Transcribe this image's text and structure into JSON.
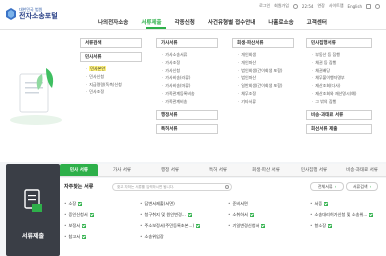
{
  "util": {
    "items": [
      "로그인",
      "회원가입",
      "22:54",
      "연장",
      "사이트맵",
      "English",
      "상담"
    ],
    "colors": {
      "accent": "#2eb04a",
      "brand": "#243c84"
    }
  },
  "logo": {
    "sub": "대한민국 법원",
    "main": "전자소송포털"
  },
  "gnb": {
    "items": [
      "나의전자소송",
      "서류제출",
      "각종신청",
      "사건유형별 접수안내",
      "나홀로소송",
      "고객센터"
    ],
    "active_index": 1
  },
  "mega": {
    "col1": {
      "head": "서류검색",
      "head2": "민사서류",
      "items": [
        "민사본안",
        "민사신청",
        "지급명령(독촉)신청",
        "민사조정"
      ],
      "highlight_index": 0
    },
    "col2": {
      "head": "가사서류",
      "items": [
        "가사소송서류",
        "가사조정",
        "가사신청",
        "가사비송(라류)",
        "가사비송(마류)",
        "가족관계등록비송",
        "가족관계비송"
      ],
      "head2": "행정서류",
      "head3": "특허서류"
    },
    "col3": {
      "head": "회생·파산서류",
      "items": [
        "개인회생",
        "개인파산",
        "법인회생(간이회생 포함)",
        "법인파산",
        "일반회생(간이회생 포함)",
        "채무조정",
        "기타서류"
      ]
    },
    "col4": {
      "head": "민사집행서류",
      "items": [
        "부동산 등 집행",
        "채권 등 집행",
        "채권배당",
        "채무불이행자명부",
        "재산조회(다사)",
        "재산조회와 재산명시(예)",
        "그 밖의 집행"
      ],
      "head2": "비송·과태료 서류",
      "head3": "회선서류 제출"
    }
  },
  "bottom": {
    "panel_label": "서류제출",
    "tabs": [
      "민사 서류",
      "가사 서류",
      "행정 서류",
      "특허 서류",
      "회생·파산 서류",
      "민사집행 서류",
      "비송·과태료 서류"
    ],
    "active_tab": 0,
    "freq_title": "자주찾는 서류",
    "search_placeholder": "찾고 자하는 서류를 입력하시면 됩니다.",
    "btn_all": "전체서류",
    "btn_set": "서류검색",
    "freq_items": [
      "소장",
      "답변서제출(서면)",
      "준비서면",
      "서증",
      "증인신청서",
      "청구취지 및 원인변경...",
      "소취하서",
      "소송대리허가신청 및 소송위...",
      "보정서",
      "주소보정서(주민등록초본...)",
      "기일변경신청서",
      "항소장",
      "참고서",
      "소송위임장"
    ]
  }
}
